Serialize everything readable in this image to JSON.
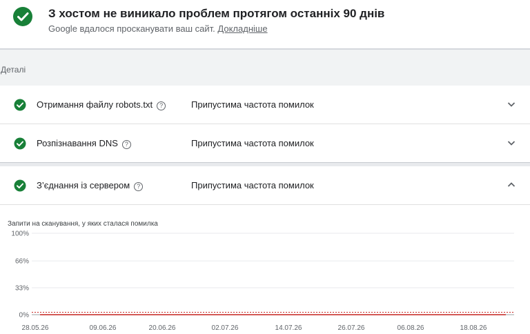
{
  "header": {
    "title": "З хостом не виникало проблем протягом останніх 90 днів",
    "subtitle": "Google вдалося просканувати ваш сайт.",
    "learn_more": "Докладніше"
  },
  "details_label": "Деталі",
  "checks": [
    {
      "name": "Отримання файлу robots.txt",
      "help": "?",
      "status": "Припустима частота помилок",
      "expanded": false
    },
    {
      "name": "Розпізнавання DNS",
      "help": "?",
      "status": "Припустима частота помилок",
      "expanded": false
    },
    {
      "name": "З’єднання із сервером",
      "help": "?",
      "status": "Припустима частота помилок",
      "expanded": true
    }
  ],
  "colors": {
    "ok_green": "#188038",
    "line_red": "#c5221f"
  },
  "chart_data": {
    "type": "line",
    "title": "Запити на сканування, у яких сталася помилка",
    "y_ticks": [
      "100%",
      "66%",
      "33%",
      "0%"
    ],
    "y_values": [
      100,
      66,
      33,
      0
    ],
    "ylim": [
      0,
      100
    ],
    "x_ticks": [
      "28.05.26",
      "09.06.26",
      "20.06.26",
      "02.07.26",
      "14.07.26",
      "26.07.26",
      "06.08.26",
      "18.08.26"
    ],
    "series": [
      {
        "values": [
          0,
          0,
          0,
          0,
          0,
          0,
          0,
          0
        ]
      }
    ],
    "threshold_percent": 3,
    "grid": true
  }
}
